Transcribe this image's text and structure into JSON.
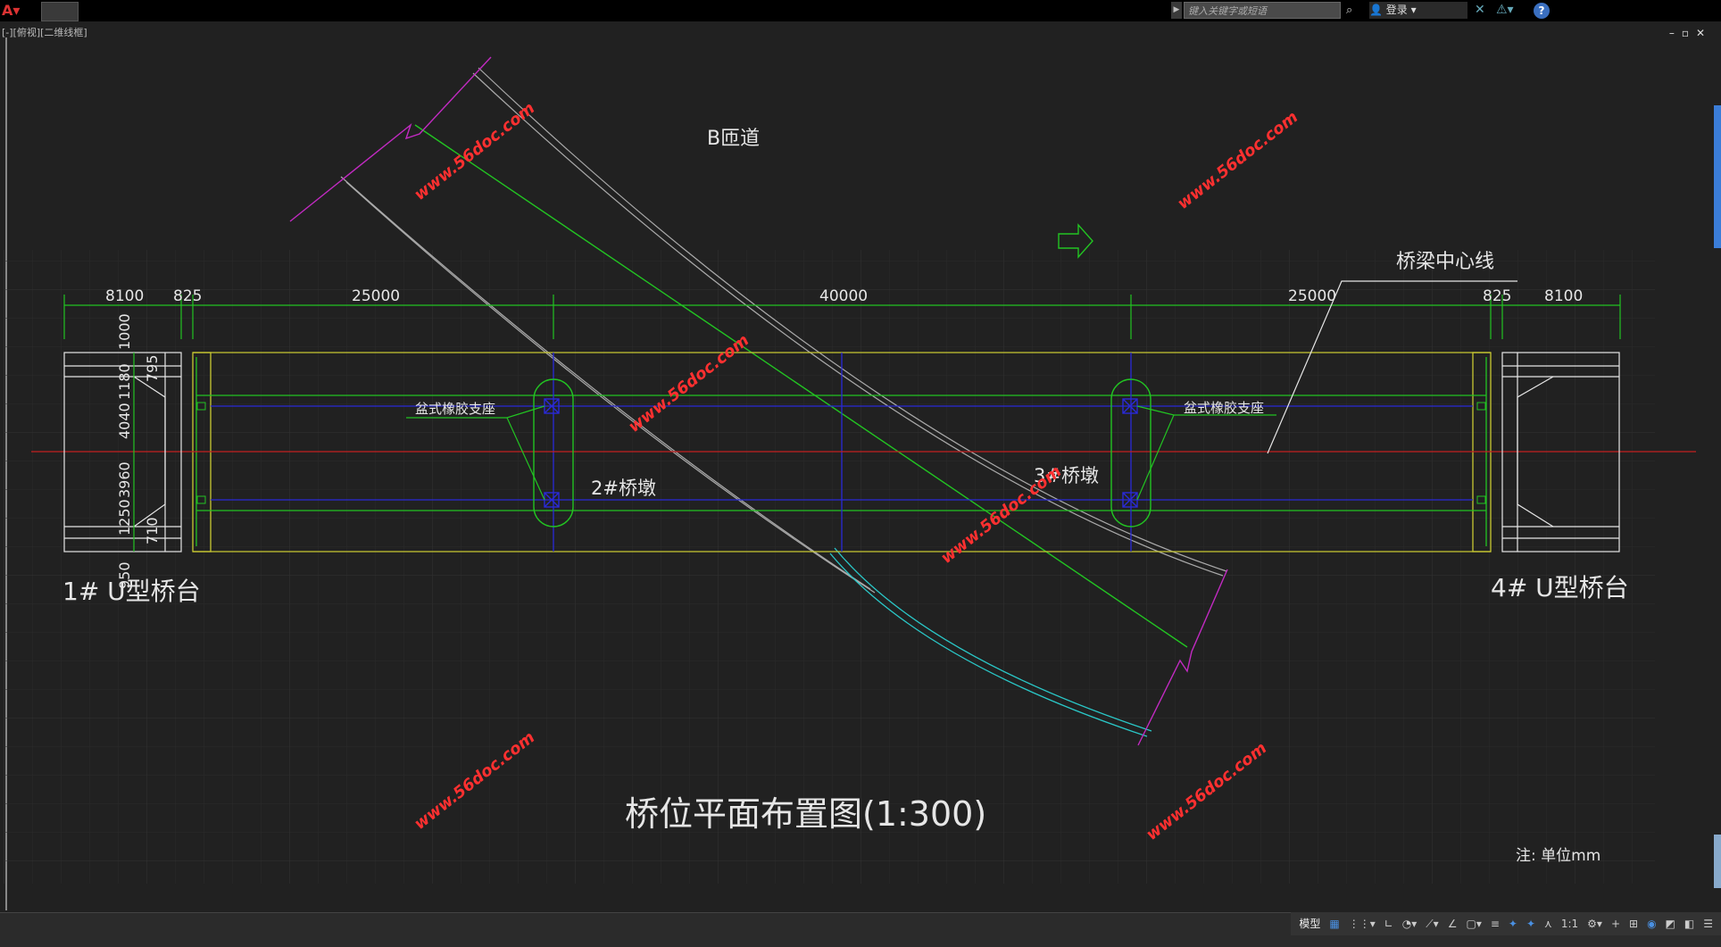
{
  "app": {
    "search_placeholder": "键入关键字或短语",
    "login_label": "登录",
    "viewport_label": "[-][俯视][二维线框]",
    "help_label": "?"
  },
  "drawing": {
    "title": "桥位平面布置图(1:300)",
    "road_label": "B匝道",
    "centerline_label": "桥梁中心线",
    "bearing_left": "盆式橡胶支座",
    "bearing_right": "盆式橡胶支座",
    "pier_2": "2#桥墩",
    "pier_3": "3#桥墩",
    "abutment_1": "1# U型桥台",
    "abutment_4": "4# U型桥台",
    "note": "注: 单位mm",
    "dims_top": [
      "8100",
      "825",
      "25000",
      "40000",
      "25000",
      "825",
      "8100"
    ],
    "dims_left": [
      "1000",
      "1180",
      "4040",
      "3960",
      "1250",
      "950"
    ],
    "dims_left2": [
      "795",
      "710"
    ],
    "watermark": "www.56doc.com"
  },
  "colors": {
    "background": "#212121",
    "green": "#22c422",
    "yellow": "#c8c832",
    "blue": "#2a2ad8",
    "red": "#c42020",
    "magenta": "#c22ac2",
    "cyan": "#2ac8c8",
    "white": "#e6e6e6",
    "watermark": "#ff3030",
    "accent": "#3b7dd8"
  },
  "status": {
    "model_tab": "模型",
    "scale": "1:1"
  }
}
